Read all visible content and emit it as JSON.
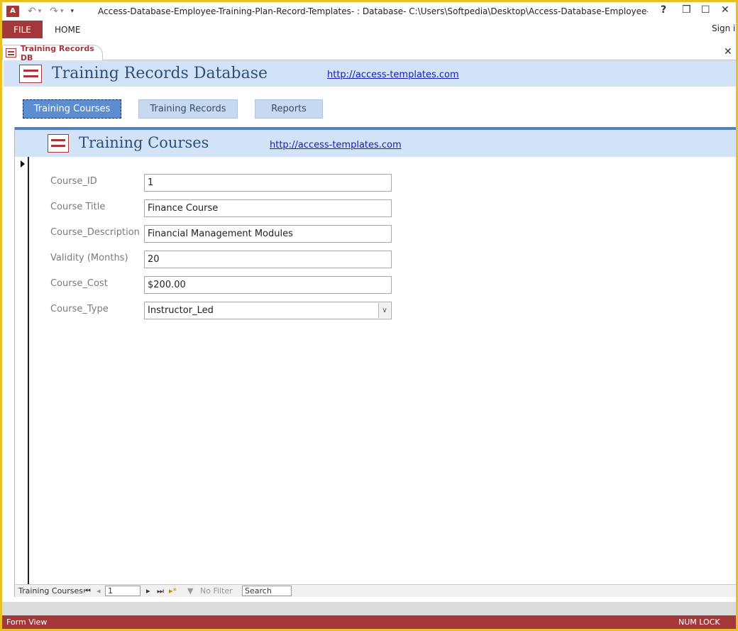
{
  "window": {
    "app_icon_label": "A",
    "title": "Access-Database-Employee-Training-Plan-Record-Templates- : Database- C:\\Users\\Softpedia\\Desktop\\Access-Database-Employee-Training-Pla...",
    "help_glyph": "?",
    "restore_glyph": "❒",
    "minimize_glyph": "—",
    "maximize_glyph": "☐",
    "close_glyph": "✕"
  },
  "quick_access": {
    "undo_glyph": "↶",
    "redo_glyph": "↷",
    "dropdown_glyph": "▾",
    "customize_glyph": "▾"
  },
  "ribbon": {
    "file_label": "FILE",
    "home_label": "HOME",
    "signin_label": "Sign in"
  },
  "document_tab": {
    "label": "Training Records DB",
    "close_glyph": "✕"
  },
  "header": {
    "title": "Training Records Database",
    "link": "http://access-templates.com"
  },
  "nav_buttons": [
    {
      "label": "Training Courses",
      "active": true
    },
    {
      "label": "Training Records",
      "active": false
    },
    {
      "label": "Reports",
      "active": false
    }
  ],
  "subform": {
    "title": "Training Courses",
    "link": "http://access-templates.com",
    "fields": [
      {
        "label": "Course_ID",
        "value": "1"
      },
      {
        "label": "Course Title",
        "value": "Finance Course"
      },
      {
        "label": "Course_Description",
        "value": "Financial Management Modules"
      },
      {
        "label": "Validity (Months)",
        "value": "20"
      },
      {
        "label": "Course_Cost",
        "value": "$200.00"
      },
      {
        "label": "Course_Type",
        "value": "Instructor_Led"
      }
    ],
    "combo_glyph": "∨"
  },
  "record_nav": {
    "label": "Training Courses",
    "first_glyph": "⏮",
    "prev_glyph": "◂",
    "current": "1",
    "next_glyph": "▸",
    "last_glyph": "⏭",
    "new_glyph": "▸*",
    "filter_label": "No Filter",
    "search_label": "Search"
  },
  "statusbar": {
    "view": "Form View",
    "numlock": "NUM LOCK"
  },
  "colors": {
    "accent_red": "#a4373a",
    "header_blue": "#d3e3f7",
    "button_blue": "#c6d9f0",
    "active_button": "#5b8ed0",
    "title_blue": "#2e4f7a",
    "window_border": "#e8c020"
  }
}
